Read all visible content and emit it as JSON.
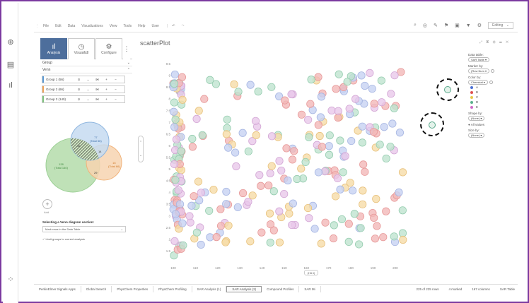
{
  "menu": [
    "File",
    "Edit",
    "Data",
    "Visualizations",
    "View",
    "Tools",
    "Help",
    "User"
  ],
  "editing_label": "Editing",
  "panel": {
    "tabs": [
      {
        "label": "Analysis",
        "icon": "bar-chart-icon"
      },
      {
        "label": "Visual&dl",
        "icon": "clock-icon"
      },
      {
        "label": "Configure",
        "icon": "gear-icon"
      }
    ],
    "section_group": "Group",
    "section_venn": "Venn",
    "groups": [
      {
        "label": "Group 1 (56)",
        "color": "#5b9bd5"
      },
      {
        "label": "Group 2 (66)",
        "color": "#f0a45a"
      },
      {
        "label": "Group 3 (140)",
        "color": "#7fc47f"
      }
    ],
    "venn": {
      "blue_count": "77",
      "blue_total": "(Total 56)",
      "green_count": "128",
      "green_total": "(Total 140)",
      "orange_count": "16",
      "orange_total": "(Total 66)",
      "bg_overlap": "16",
      "triple": "14",
      "go_overlap": "29"
    },
    "add_label": "Add",
    "select_title": "Selecting a Venn diagram section:",
    "select_value": "Mark rows in the Data Table",
    "checkbox_label": "Limit groups to current analysis"
  },
  "plot": {
    "title": "scatterPlot",
    "x_button": "(Hit ▾)"
  },
  "legend": {
    "data_table_label": "Data table:",
    "data_table_value": "SAR Table ▾",
    "marker_label": "Marker by:",
    "marker_value": "(Row Num ▾",
    "color_label": "Color by:",
    "color_value": "Chemical ▾",
    "color_items": [
      {
        "label": "A",
        "color": "#4a6fd4"
      },
      {
        "label": "B",
        "color": "#e05050"
      },
      {
        "label": "C",
        "color": "#e8c84a"
      },
      {
        "label": "D",
        "color": "#5ab08c"
      },
      {
        "label": "E",
        "color": "#d06bc8"
      }
    ],
    "shape_label": "Shape by:",
    "shape_value": "(None) ▾",
    "all_values": "All values",
    "size_label": "Size by:",
    "size_value": "(None) ▾"
  },
  "chart_data": {
    "type": "scatter",
    "xlim": [
      100,
      230
    ],
    "ylim": [
      1,
      10
    ],
    "xticks": [
      100,
      110,
      120,
      130,
      140,
      150,
      160,
      170,
      180,
      190,
      200
    ],
    "yticks": [
      1.5,
      2,
      2.5,
      3,
      3.5,
      4,
      4.5,
      5,
      5.5,
      6,
      6.5,
      7,
      7.5,
      8,
      8.5,
      9,
      9.5
    ],
    "point_colors": [
      "#f2b8b8",
      "#f6dca8",
      "#c7d2f2",
      "#bfe3cf",
      "#e9c8ea"
    ],
    "highlight_points": [
      {
        "x": 213,
        "y": 8.3
      },
      {
        "x": 209,
        "y": 6.6
      }
    ],
    "seed": 7
  },
  "statusbar": {
    "tabs": [
      "PerkinElmer Signals Apps",
      "Global Search",
      "PhysChem Properties",
      "PhysChem Profiling",
      "SAR Analysis (1)",
      "SAR Analysis (2)",
      "Compound Profiles",
      "SAR Mi"
    ],
    "active_index": 5,
    "rows": "225 of 225 rows",
    "marked": "4 marked",
    "columns": "167 columns",
    "table": "SAR Table"
  }
}
